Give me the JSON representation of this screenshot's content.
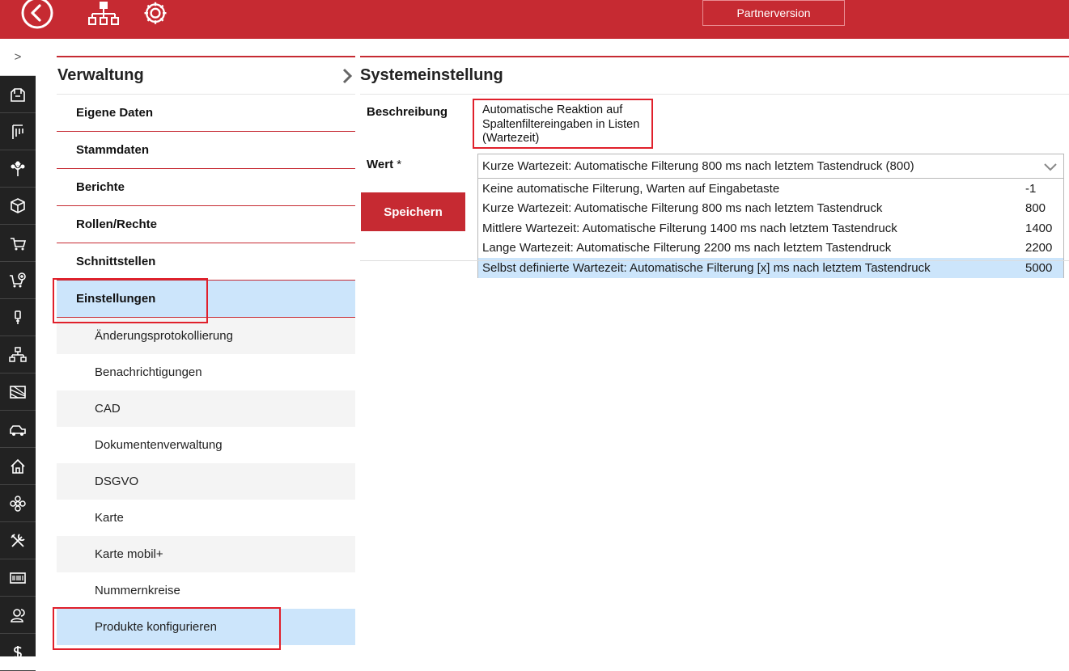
{
  "topbar": {
    "partner_label": "Partnerversion",
    "color": "#c62a32",
    "icons": [
      "back-arrow-icon",
      "sitemap-icon",
      "gear-icon"
    ]
  },
  "sidebar": {
    "expand_glyph": ">",
    "rail_icons": [
      "contacts-icon",
      "measure-icon",
      "tree-icon",
      "cube-icon",
      "cart-icon",
      "shopping-cart-add-icon",
      "usb-plug-icon",
      "hierarchy-icon",
      "map-icon",
      "vehicles-icon",
      "home-icon",
      "flower-icon",
      "tools-icon",
      "barcode-icon",
      "user-group-icon",
      "money-icon"
    ]
  },
  "nav": {
    "title": "Verwaltung",
    "items": [
      {
        "label": "Eigene Daten"
      },
      {
        "label": "Stammdaten"
      },
      {
        "label": "Berichte"
      },
      {
        "label": "Rollen/Rechte"
      },
      {
        "label": "Schnittstellen"
      },
      {
        "label": "Einstellungen"
      }
    ],
    "sub_items": [
      {
        "label": "Änderungsprotokollierung"
      },
      {
        "label": "Benachrichtigungen"
      },
      {
        "label": "CAD"
      },
      {
        "label": "Dokumentenverwaltung"
      },
      {
        "label": "DSGVO"
      },
      {
        "label": "Karte"
      },
      {
        "label": "Karte mobil+"
      },
      {
        "label": "Nummernkreise"
      },
      {
        "label": "Produkte konfigurieren"
      }
    ]
  },
  "panel": {
    "title": "Systemeinstellung",
    "description_label": "Beschreibung",
    "description_lines": [
      "Automatische Reaktion auf",
      "Spaltenfiltereingaben in Listen",
      "(Wartezeit)"
    ],
    "value_label": "Wert",
    "required_marker": "*",
    "selected_value": "Kurze Wartezeit: Automatische Filterung 800 ms nach letztem Tastendruck (800)",
    "options": [
      {
        "label": "Keine automatische Filterung, Warten auf Eingabetaste",
        "value": "-1"
      },
      {
        "label": "Kurze Wartezeit: Automatische Filterung 800 ms nach letztem Tastendruck",
        "value": "800"
      },
      {
        "label": "Mittlere Wartezeit: Automatische Filterung 1400 ms nach letztem Tastendruck",
        "value": "1400"
      },
      {
        "label": "Lange Wartezeit: Automatische Filterung 2200 ms nach letztem Tastendruck",
        "value": "2200"
      },
      {
        "label": "Selbst definierte Wartezeit: Automatische Filterung [x] ms nach letztem Tastendruck",
        "value": "5000"
      }
    ],
    "save_label": "Speichern"
  }
}
